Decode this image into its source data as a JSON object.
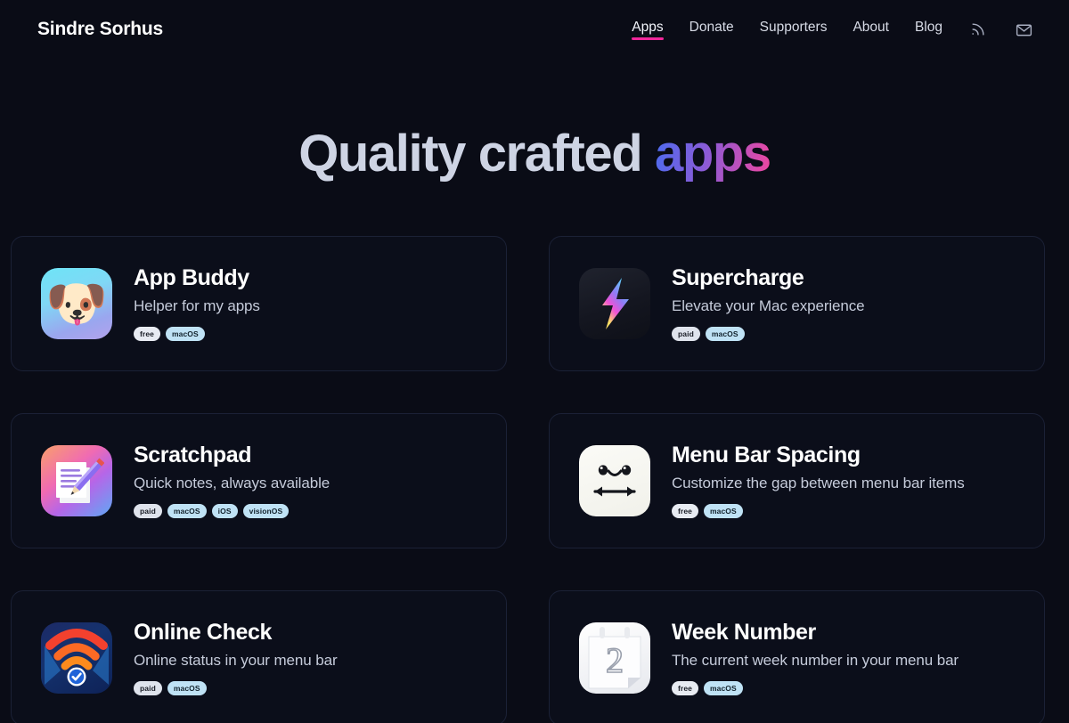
{
  "header": {
    "brand": "Sindre Sorhus",
    "nav": [
      {
        "label": "Apps",
        "active": true
      },
      {
        "label": "Donate",
        "active": false
      },
      {
        "label": "Supporters",
        "active": false
      },
      {
        "label": "About",
        "active": false
      },
      {
        "label": "Blog",
        "active": false
      }
    ],
    "icons": [
      {
        "name": "rss-icon"
      },
      {
        "name": "mail-icon"
      }
    ],
    "accent_color": "#f0269a"
  },
  "hero": {
    "title_plain": "Quality crafted ",
    "title_gradient": "apps",
    "gradient_colors": [
      "#4a6cf0",
      "#8b5bd6",
      "#f0469f"
    ]
  },
  "apps": [
    {
      "name": "App Buddy",
      "tagline": "Helper for my apps",
      "icon": "dog-face-icon",
      "tags": [
        {
          "label": "free",
          "type": "price"
        },
        {
          "label": "macOS",
          "type": "os"
        }
      ]
    },
    {
      "name": "Supercharge",
      "tagline": "Elevate your Mac experience",
      "icon": "lightning-bolt-icon",
      "tags": [
        {
          "label": "paid",
          "type": "price"
        },
        {
          "label": "macOS",
          "type": "os"
        }
      ]
    },
    {
      "name": "Scratchpad",
      "tagline": "Quick notes, always available",
      "icon": "memo-pencil-icon",
      "tags": [
        {
          "label": "paid",
          "type": "price"
        },
        {
          "label": "macOS",
          "type": "os"
        },
        {
          "label": "iOS",
          "type": "os"
        },
        {
          "label": "visionOS",
          "type": "os"
        }
      ]
    },
    {
      "name": "Menu Bar Spacing",
      "tagline": "Customize the gap between menu bar items",
      "icon": "smiley-arrows-icon",
      "tags": [
        {
          "label": "free",
          "type": "price"
        },
        {
          "label": "macOS",
          "type": "os"
        }
      ]
    },
    {
      "name": "Online Check",
      "tagline": "Online status in your menu bar",
      "icon": "wifi-check-icon",
      "tags": [
        {
          "label": "paid",
          "type": "price"
        },
        {
          "label": "macOS",
          "type": "os"
        }
      ]
    },
    {
      "name": "Week Number",
      "tagline": "The current week number in your menu bar",
      "icon": "calendar-icon",
      "calendar_number": "2",
      "tags": [
        {
          "label": "free",
          "type": "price"
        },
        {
          "label": "macOS",
          "type": "os"
        }
      ]
    }
  ]
}
